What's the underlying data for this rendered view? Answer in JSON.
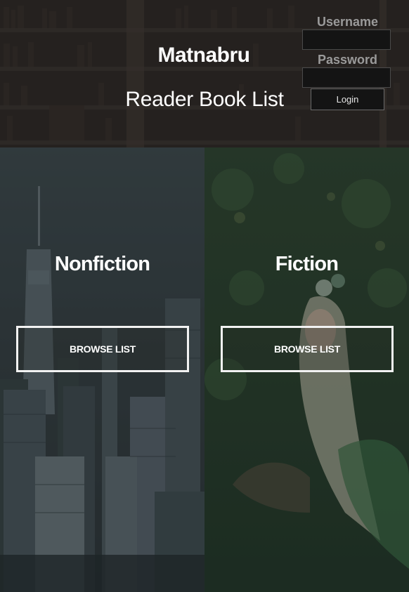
{
  "header": {
    "site_name": "Matnabru",
    "subtitle": "Reader Book List"
  },
  "login": {
    "username_label": "Username",
    "password_label": "Password",
    "username_value": "",
    "password_value": "",
    "button_label": "Login"
  },
  "categories": [
    {
      "title": "Nonfiction",
      "button_label": "BROWSE LIST"
    },
    {
      "title": "Fiction",
      "button_label": "BROWSE LIST"
    }
  ],
  "colors": {
    "header_bg": "#2a2624",
    "input_bg": "#141414",
    "label": "#9a9a9a",
    "nonfiction_tint": "#2c3437",
    "fiction_tint": "#243526"
  }
}
